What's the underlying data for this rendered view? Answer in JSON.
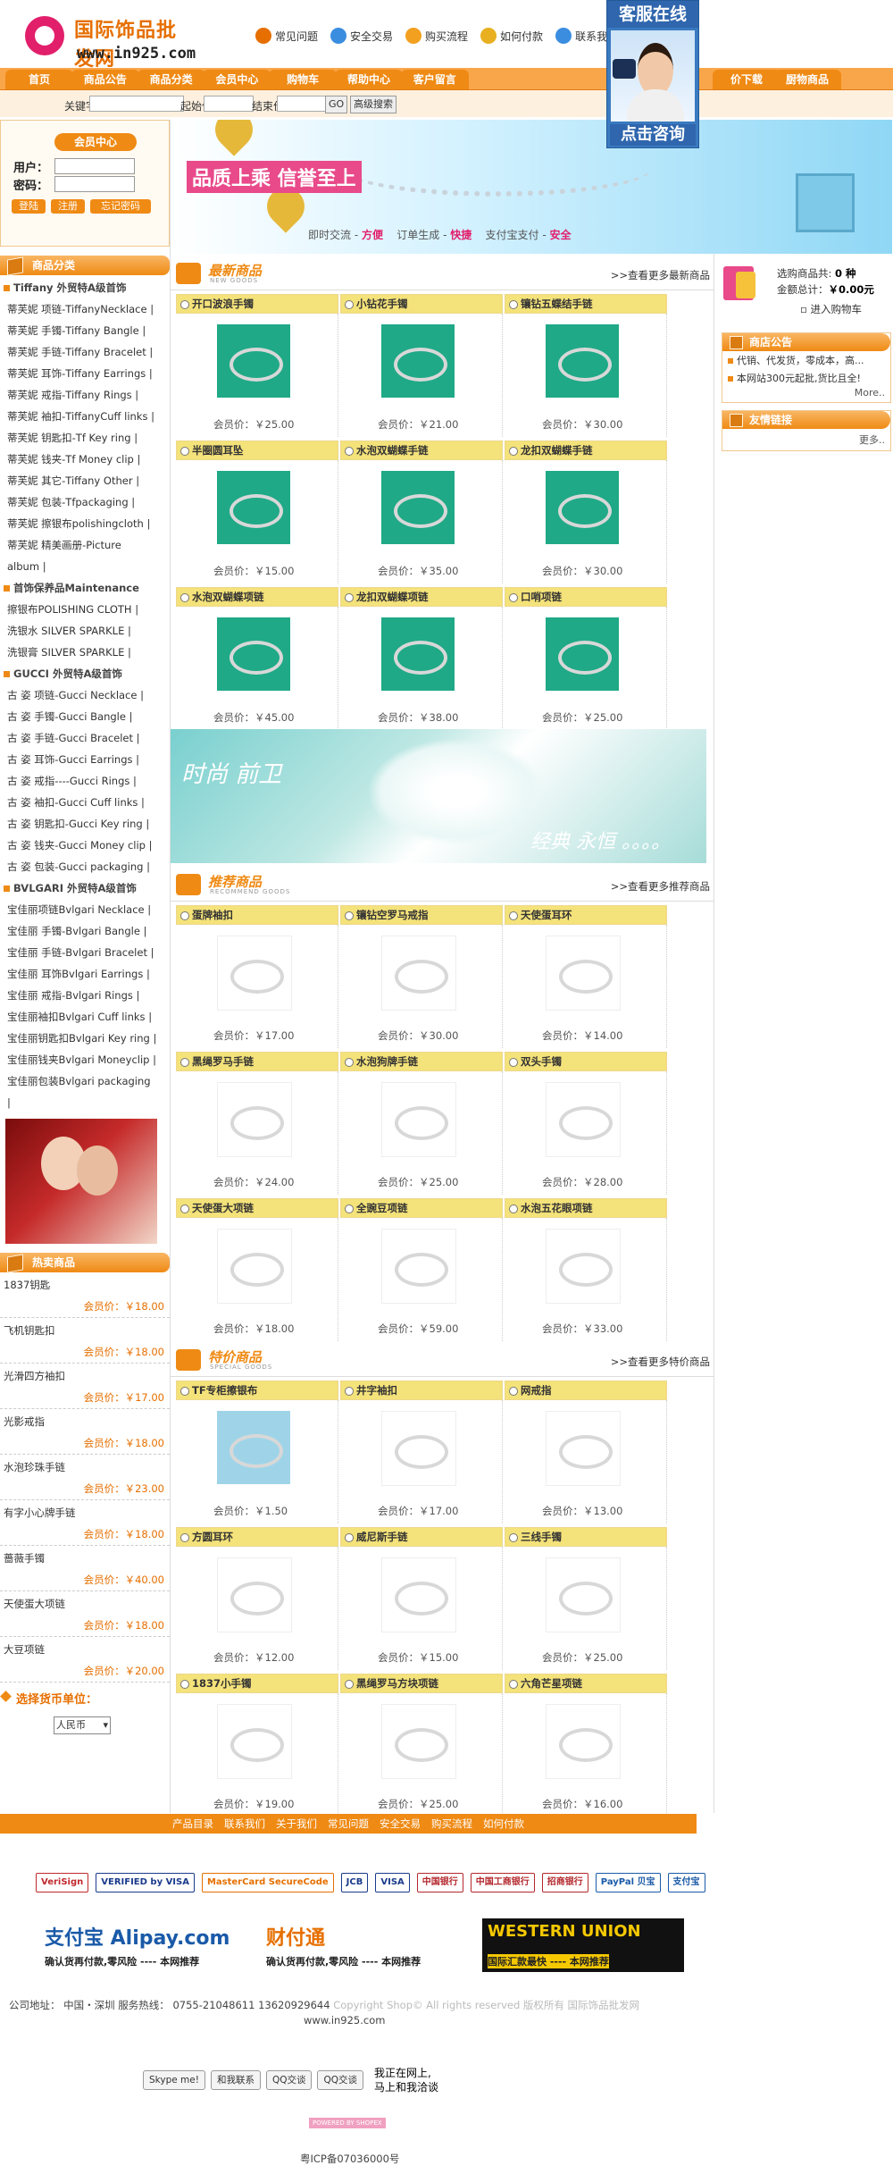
{
  "site": {
    "name": "国际饰品批发网",
    "url": "www.in925.com"
  },
  "top_links": [
    {
      "label": "常见问题",
      "color": "#e66f00",
      "icon": "question-icon"
    },
    {
      "label": "安全交易",
      "color": "#3b8de0",
      "icon": "shield-icon"
    },
    {
      "label": "购买流程",
      "color": "#f2a020",
      "icon": "flow-icon"
    },
    {
      "label": "如何付款",
      "color": "#e8b020",
      "icon": "money-bag-icon"
    },
    {
      "label": "联系我们",
      "color": "#3b8de0",
      "icon": "contact-icon"
    }
  ],
  "service": {
    "title": "客服在线",
    "button": "点击咨询"
  },
  "nav": [
    "首页",
    "商品公告",
    "商品分类",
    "会员中心",
    "购物车",
    "帮助中心",
    "客户留言",
    "价下载",
    "厨物商品"
  ],
  "search": {
    "keyword_label": "关键字",
    "start_price_label": "起始价",
    "end_price_label": "结束价",
    "go_button": "GO",
    "advanced_button": "高级搜索"
  },
  "member": {
    "title": "会员中心",
    "user_label": "用户：",
    "password_label": "密码：",
    "login": "登陆",
    "register": "注册",
    "forgot": "忘记密码"
  },
  "banner1": {
    "slogan": "品质上乘 信誉至上",
    "sub_a": "即时交流 - ",
    "sub_a_b": "方便",
    "sub_b": "订单生成 - ",
    "sub_b_b": "快捷",
    "sub_c": "支付宝支付 - ",
    "sub_c_b": "安全"
  },
  "categories": {
    "title": "商品分类",
    "rows": [
      {
        "type": "group",
        "label": "Tiffany 外贸特A级首饰"
      },
      {
        "type": "item",
        "label": "蒂芙妮 项链-TiffanyNecklace  |"
      },
      {
        "type": "item",
        "label": "蒂芙妮 手镯-Tiffany Bangle  |"
      },
      {
        "type": "item",
        "label": "蒂芙妮 手链-Tiffany Bracelet  |"
      },
      {
        "type": "item",
        "label": "蒂芙妮 耳饰-Tiffany Earrings  |"
      },
      {
        "type": "item",
        "label": "蒂芙妮 戒指-Tiffany Rings  |"
      },
      {
        "type": "item",
        "label": "蒂芙妮 袖扣-TiffanyCuff links  |"
      },
      {
        "type": "item",
        "label": "蒂芙妮 钥匙扣-Tf Key ring  |"
      },
      {
        "type": "item",
        "label": "蒂芙妮 钱夹-Tf Money clip  |"
      },
      {
        "type": "item",
        "label": "蒂芙妮 其它-Tiffany Other  |"
      },
      {
        "type": "item",
        "label": "蒂芙妮 包装-Tfpackaging  |"
      },
      {
        "type": "item",
        "label": "蒂芙妮 擦银布polishingcloth  |"
      },
      {
        "type": "item",
        "label": "蒂芙妮 精美画册-Picture"
      },
      {
        "type": "item",
        "label": "album  |"
      },
      {
        "type": "group",
        "label": "首饰保养品Maintenance"
      },
      {
        "type": "item",
        "label": "擦银布POLISHING CLOTH  |"
      },
      {
        "type": "item",
        "label": "洗银水 SILVER SPARKLE  |"
      },
      {
        "type": "item",
        "label": "洗银膏 SILVER SPARKLE  |"
      },
      {
        "type": "group",
        "label": "GUCCI 外贸特A级首饰"
      },
      {
        "type": "item",
        "label": "古 姿 项链-Gucci Necklace  |"
      },
      {
        "type": "item",
        "label": "古 姿 手镯-Gucci Bangle  |"
      },
      {
        "type": "item",
        "label": "古 姿 手链-Gucci Bracelet  |"
      },
      {
        "type": "item",
        "label": "古 姿 耳饰-Gucci Earrings  |"
      },
      {
        "type": "item",
        "label": "古 姿 戒指----Gucci Rings  |"
      },
      {
        "type": "item",
        "label": "古 姿 袖扣-Gucci Cuff links  |"
      },
      {
        "type": "item",
        "label": "古 姿 钥匙扣-Gucci Key ring  |"
      },
      {
        "type": "item",
        "label": "古 姿 钱夹-Gucci Money clip  |"
      },
      {
        "type": "item",
        "label": "古 姿 包装-Gucci packaging  |"
      },
      {
        "type": "group",
        "label": "BVLGARI 外贸特A级首饰"
      },
      {
        "type": "item",
        "label": "宝佳丽项链Bvlgari Necklace  |"
      },
      {
        "type": "item",
        "label": "宝佳丽 手镯-Bvlgari Bangle  |"
      },
      {
        "type": "item",
        "label": "宝佳丽 手链-Bvlgari Bracelet  |"
      },
      {
        "type": "item",
        "label": "宝佳丽 耳饰Bvlgari Earrings  |"
      },
      {
        "type": "item",
        "label": "宝佳丽 戒指-Bvlgari Rings  |"
      },
      {
        "type": "item",
        "label": "宝佳丽袖扣Bvlgari Cuff links  |"
      },
      {
        "type": "item",
        "label": "宝佳丽钥匙扣Bvlgari Key ring  |"
      },
      {
        "type": "item",
        "label": "宝佳丽钱夹Bvlgari Moneyclip  |"
      },
      {
        "type": "item",
        "label": "宝佳丽包装Bvlgari packaging"
      },
      {
        "type": "item",
        "label": "|"
      }
    ]
  },
  "hot": {
    "title": "热卖商品",
    "items": [
      {
        "name": "1837钥匙",
        "price": "会员价：￥18.00"
      },
      {
        "name": "飞机钥匙扣",
        "price": "会员价：￥18.00"
      },
      {
        "name": "光滑四方袖扣",
        "price": "会员价：￥17.00"
      },
      {
        "name": "光影戒指",
        "price": "会员价：￥18.00"
      },
      {
        "name": "水泡珍珠手链",
        "price": "会员价：￥23.00"
      },
      {
        "name": "有字小心牌手链",
        "price": "会员价：￥18.00"
      },
      {
        "name": "蔷薇手镯",
        "price": "会员价：￥40.00"
      },
      {
        "name": "天使蛋大项链",
        "price": "会员价：￥18.00"
      },
      {
        "name": "大豆项链",
        "price": "会员价：￥20.00"
      }
    ]
  },
  "currency": {
    "title": "选择货币单位：",
    "selected": "人民币"
  },
  "cart": {
    "count_label": "选购商品共: ",
    "count": "0 种",
    "total_label": "金额总计：",
    "total": "￥0.00元",
    "enter": "进入购物车"
  },
  "notice": {
    "title": "商店公告",
    "lines": [
      "代销、代发货，零成本，高...",
      "本网站300元起批,货比且全!"
    ],
    "more": "More.."
  },
  "links": {
    "title": "友情链接",
    "more": "更多.."
  },
  "new_goods": {
    "title": "最新商品",
    "subtitle": "NEW GOODS",
    "more": ">>查看更多最新商品",
    "items": [
      {
        "name": "开口波浪手镯",
        "price": "会员价：￥25.00",
        "bg": "teal"
      },
      {
        "name": "小钻花手镯",
        "price": "会员价：￥21.00",
        "bg": "teal"
      },
      {
        "name": "镶钻五蝶结手链",
        "price": "会员价：￥30.00",
        "bg": "teal"
      },
      {
        "name": "半圈圆耳坠",
        "price": "会员价：￥15.00",
        "bg": "teal"
      },
      {
        "name": "水泡双蝴蝶手链",
        "price": "会员价：￥35.00",
        "bg": "teal"
      },
      {
        "name": "龙扣双蝴蝶手链",
        "price": "会员价：￥30.00",
        "bg": "teal"
      },
      {
        "name": "水泡双蝴蝶项链",
        "price": "会员价：￥45.00",
        "bg": "teal"
      },
      {
        "name": "龙扣双蝴蝶项链",
        "price": "会员价：￥38.00",
        "bg": "teal"
      },
      {
        "name": "口哨项链",
        "price": "会员价：￥25.00",
        "bg": "teal"
      }
    ]
  },
  "banner2": {
    "left": "时尚 前卫",
    "right": "经典 永恒 。。。。"
  },
  "recommend": {
    "title": "推荐商品",
    "subtitle": "RECOMMEND GOODS",
    "more": ">>查看更多推荐商品",
    "items": [
      {
        "name": "蛋牌袖扣",
        "price": "会员价：￥17.00",
        "bg": "white"
      },
      {
        "name": "镶钻空罗马戒指",
        "price": "会员价：￥30.00",
        "bg": "white"
      },
      {
        "name": "天使蛋耳环",
        "price": "会员价：￥14.00",
        "bg": "white"
      },
      {
        "name": "黑绳罗马手链",
        "price": "会员价：￥24.00",
        "bg": "white"
      },
      {
        "name": "水泡狗牌手链",
        "price": "会员价：￥25.00",
        "bg": "white"
      },
      {
        "name": "双头手镯",
        "price": "会员价：￥28.00",
        "bg": "white"
      },
      {
        "name": "天使蛋大项链",
        "price": "会员价：￥18.00",
        "bg": "white"
      },
      {
        "name": "全豌豆项链",
        "price": "会员价：￥59.00",
        "bg": "white"
      },
      {
        "name": "水泡五花眼项链",
        "price": "会员价：￥33.00",
        "bg": "white"
      }
    ]
  },
  "special": {
    "title": "特价商品",
    "subtitle": "SPECIAL GOODS",
    "more": ">>查看更多特价商品",
    "items": [
      {
        "name": "TF专柜擦银布",
        "price": "会员价：￥1.50",
        "bg": "lb"
      },
      {
        "name": "井字袖扣",
        "price": "会员价：￥17.00",
        "bg": "white"
      },
      {
        "name": "网戒指",
        "price": "会员价：￥13.00",
        "bg": "white"
      },
      {
        "name": "方圆耳环",
        "price": "会员价：￥12.00",
        "bg": "white"
      },
      {
        "name": "威尼斯手链",
        "price": "会员价：￥15.00",
        "bg": "white"
      },
      {
        "name": "三线手镯",
        "price": "会员价：￥25.00",
        "bg": "white"
      },
      {
        "name": "1837小手镯",
        "price": "会员价：￥19.00",
        "bg": "white"
      },
      {
        "name": "黑绳罗马方块项链",
        "price": "会员价：￥25.00",
        "bg": "white"
      },
      {
        "name": "六角芒星项链",
        "price": "会员价：￥16.00",
        "bg": "white"
      }
    ]
  },
  "footer": {
    "nav": [
      "产品目录",
      "联系我们",
      "关于我们",
      "常见问题",
      "安全交易",
      "购买流程",
      "如何付款"
    ],
    "pay_logos": [
      {
        "label": "VeriSign",
        "color": "#c0282d"
      },
      {
        "label": "VERIFIED by VISA",
        "color": "#1a3a8c"
      },
      {
        "label": "MasterCard SecureCode",
        "color": "#e66f00"
      },
      {
        "label": "JCB",
        "color": "#1a3a8c"
      },
      {
        "label": "VISA",
        "color": "#1a3a8c"
      },
      {
        "label": "中国银行",
        "color": "#b4282d"
      },
      {
        "label": "中国工商银行",
        "color": "#b4282d"
      },
      {
        "label": "招商银行",
        "color": "#b4282d"
      },
      {
        "label": "PayPal 贝宝",
        "color": "#1a5aa8"
      },
      {
        "label": "支付宝",
        "color": "#1a5aa8"
      }
    ],
    "alipay_name": "支付宝 Alipay.com",
    "alipay_sub": "确认货再付款,零风险 ---- 本网推荐",
    "tenpay_name": "财付通",
    "tenpay_sub": "确认货再付款,零风险 ---- 本网推荐",
    "wu_name": "WESTERN UNION",
    "wu_sub": "国际汇款最快 ---- 本网推荐",
    "copyright_a": "公司地址：  中国・深圳    服务热线：  0755-21048611   13620929644  ",
    "copyright_b": "Copyright Shop©  All rights reserved 版权所有  国际饰品批发网",
    "site_url": "www.in925.com",
    "contacts": [
      "Skype me!",
      "和我联系",
      "QQ交谈",
      "QQ交谈"
    ],
    "chat_text_1": "我正在网上,",
    "chat_text_2": "马上和我洽谈",
    "powered": "POWERED BY SHOPEX",
    "icp": "粤ICP备07036000号"
  }
}
